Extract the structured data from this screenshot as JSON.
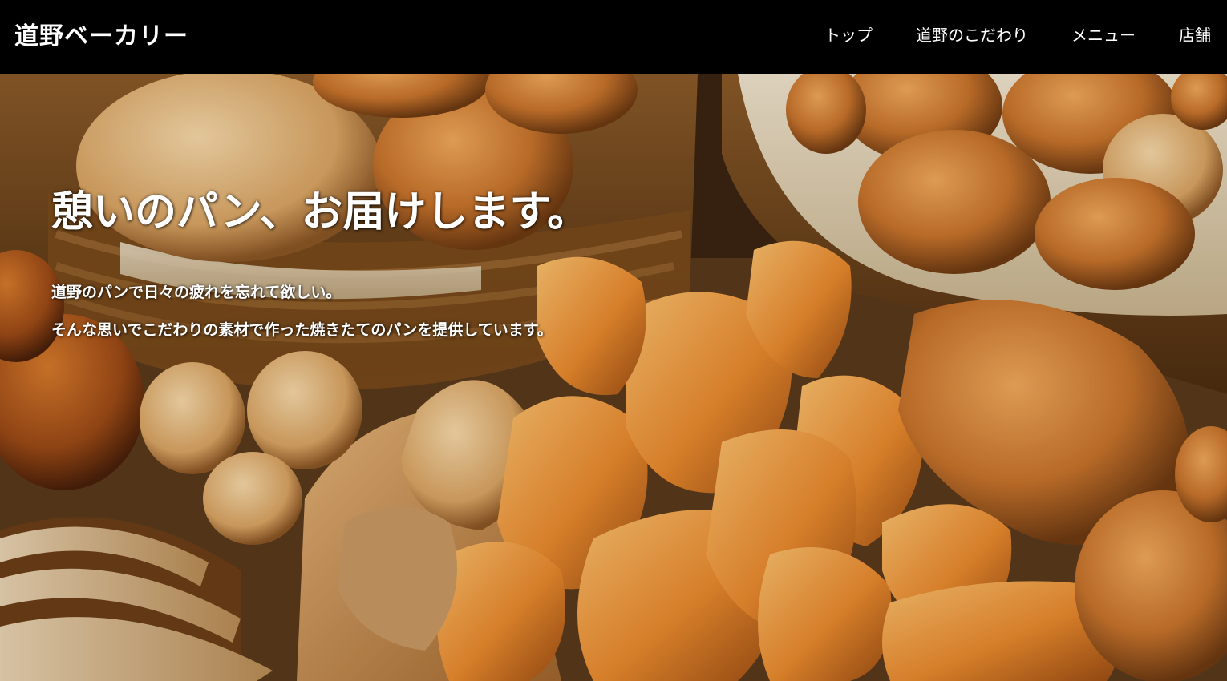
{
  "header": {
    "logo": "道野ベーカリー",
    "nav": [
      {
        "label": "トップ"
      },
      {
        "label": "道野のこだわり"
      },
      {
        "label": "メニュー"
      },
      {
        "label": "店舗"
      }
    ]
  },
  "hero": {
    "title": "憩いのパン、お届けします。",
    "lines": [
      "道野のパンで日々の疲れを忘れて欲しい。",
      "そんな思いでこだわりの素材で作った焼きたてのパンを提供しています。"
    ],
    "image": "assorted-bread-photo"
  },
  "colors": {
    "header_bg": "#000000",
    "text": "#ffffff"
  }
}
